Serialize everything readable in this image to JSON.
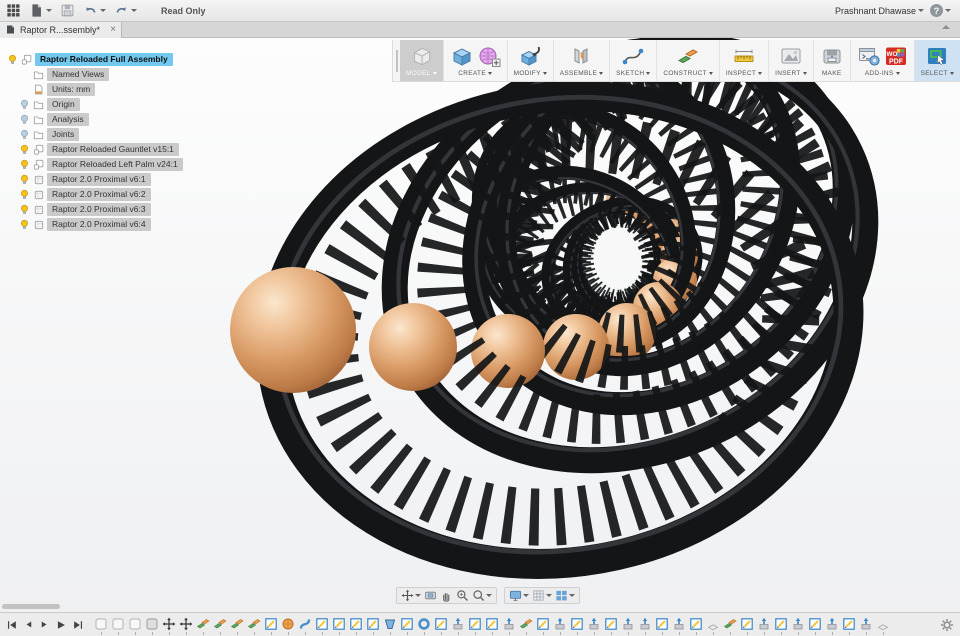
{
  "topbar": {
    "left_icons": [
      "app-grid",
      "file-menu",
      "save",
      "undo",
      "redo"
    ],
    "read_only_label": "Read Only",
    "user_name": "Prashnant Dhawase",
    "help_label": "?"
  },
  "tab_bar": {
    "active_tab": {
      "title": "Raptor R...ssembly*",
      "close_label": "×"
    }
  },
  "toolbar": {
    "groups": [
      {
        "label": "MODEL",
        "caret": true,
        "pressed": true,
        "selected": false,
        "icons": [
          "model-cube"
        ]
      },
      {
        "label": "CREATE",
        "caret": true,
        "pressed": false,
        "selected": false,
        "icons": [
          "create-box",
          "create-form"
        ]
      },
      {
        "label": "MODIFY",
        "caret": true,
        "pressed": false,
        "selected": false,
        "icons": [
          "modify-press"
        ]
      },
      {
        "label": "ASSEMBLE",
        "caret": true,
        "pressed": false,
        "selected": false,
        "icons": [
          "assemble-joint"
        ]
      },
      {
        "label": "SKETCH",
        "caret": true,
        "pressed": false,
        "selected": false,
        "icons": [
          "sketch-spline"
        ]
      },
      {
        "label": "CONSTRUCT",
        "caret": true,
        "pressed": false,
        "selected": false,
        "icons": [
          "construct-planes"
        ]
      },
      {
        "label": "INSPECT",
        "caret": true,
        "pressed": false,
        "selected": false,
        "icons": [
          "inspect-measure"
        ]
      },
      {
        "label": "INSERT",
        "caret": true,
        "pressed": false,
        "selected": false,
        "icons": [
          "insert-image"
        ]
      },
      {
        "label": "MAKE",
        "caret": false,
        "pressed": false,
        "selected": false,
        "icons": [
          "make-print"
        ]
      },
      {
        "label": "ADD-INS",
        "caret": true,
        "pressed": false,
        "selected": false,
        "icons": [
          "addins-scripts",
          "addins-pdf"
        ]
      },
      {
        "label": "SELECT",
        "caret": true,
        "pressed": false,
        "selected": true,
        "icons": [
          "select-tool"
        ]
      }
    ]
  },
  "browser": {
    "items": [
      {
        "label": "Raptor Reloaded Full Assembly",
        "icon": "component",
        "bulb": "on",
        "selected": true,
        "level": 0
      },
      {
        "label": "Named Views",
        "icon": "folder",
        "bulb": null,
        "selected": false,
        "level": 1
      },
      {
        "label": "Units: mm",
        "icon": "units-doc",
        "bulb": null,
        "selected": false,
        "level": 1
      },
      {
        "label": "Origin",
        "icon": "folder",
        "bulb": "off",
        "selected": false,
        "level": 1
      },
      {
        "label": "Analysis",
        "icon": "folder",
        "bulb": "off",
        "selected": false,
        "level": 1
      },
      {
        "label": "Joints",
        "icon": "folder",
        "bulb": "off",
        "selected": false,
        "level": 1
      },
      {
        "label": "Raptor Reloaded Gauntlet v15:1",
        "icon": "component",
        "bulb": "on",
        "selected": false,
        "level": 1
      },
      {
        "label": "Raptor Reloaded Left Palm v24:1",
        "icon": "component",
        "bulb": "on",
        "selected": false,
        "level": 1
      },
      {
        "label": "Raptor 2.0 Proximal v6:1",
        "icon": "body",
        "bulb": "on",
        "selected": false,
        "level": 1
      },
      {
        "label": "Raptor 2.0 Proximal v6:2",
        "icon": "body",
        "bulb": "on",
        "selected": false,
        "level": 1
      },
      {
        "label": "Raptor 2.0 Proximal v6:3",
        "icon": "body",
        "bulb": "on",
        "selected": false,
        "level": 1
      },
      {
        "label": "Raptor 2.0 Proximal v6:4",
        "icon": "body",
        "bulb": "on",
        "selected": false,
        "level": 1
      }
    ]
  },
  "navbar": {
    "groups": [
      {
        "items": [
          {
            "name": "orbit",
            "caret": true
          },
          {
            "name": "look-at",
            "caret": false
          },
          {
            "name": "pan",
            "caret": false
          },
          {
            "name": "zoom",
            "caret": false
          },
          {
            "name": "fit",
            "caret": true
          }
        ]
      },
      {
        "items": [
          {
            "name": "display-settings",
            "caret": true
          },
          {
            "name": "grid-settings",
            "caret": true
          },
          {
            "name": "viewports",
            "caret": true
          }
        ]
      }
    ]
  },
  "timeline": {
    "playback": [
      "go-to-start",
      "step-back",
      "step-forward",
      "play",
      "go-to-end"
    ],
    "items": [
      "component",
      "component",
      "component",
      "body",
      "move",
      "move",
      "plane",
      "plane",
      "plane",
      "plane",
      "sketch",
      "form",
      "sweep",
      "sketch",
      "sketch",
      "sketch",
      "sketch",
      "loft",
      "sketch",
      "torus",
      "sketch",
      "extrude",
      "sketch",
      "sketch",
      "extrude",
      "plane",
      "sketch",
      "extrude",
      "sketch",
      "extrude",
      "sketch",
      "extrude",
      "extrude",
      "sketch",
      "extrude",
      "sketch",
      "fillet",
      "plane",
      "sketch",
      "extrude",
      "sketch",
      "extrude",
      "sketch",
      "extrude",
      "sketch",
      "extrude",
      "fillet"
    ],
    "settings_icon": "gear"
  },
  "viewport": {
    "description": "spiral assembly of black carbon-fiber gauntlet rings with copper spheres",
    "ring_color": "#141517",
    "ring_highlight": "#4d5158",
    "copper_stops": [
      "#fbe7cd",
      "#f0c49a",
      "#d99b66",
      "#bc7a46",
      "#8e5630"
    ],
    "rings": [
      [
        560,
        330,
        290,
        232,
        -10,
        30
      ],
      [
        630,
        255,
        243,
        196,
        -25,
        26
      ],
      [
        659,
        225,
        200,
        162,
        -40,
        23
      ],
      [
        648,
        205,
        168,
        134,
        -62,
        20
      ],
      [
        612,
        205,
        140,
        114,
        -95,
        18
      ],
      [
        584,
        222,
        118,
        96,
        -126,
        16
      ],
      [
        578,
        258,
        100,
        82,
        -156,
        14
      ],
      [
        590,
        260,
        88,
        72,
        178,
        12
      ],
      [
        622,
        266,
        77,
        62,
        158,
        11
      ],
      [
        610,
        266,
        67,
        54,
        139,
        10
      ],
      [
        618,
        260,
        59,
        48,
        119,
        9
      ],
      [
        618,
        258,
        53,
        43,
        102,
        8
      ],
      [
        618,
        258,
        48,
        39,
        88,
        7
      ]
    ],
    "spheres": [
      [
        293,
        330,
        63
      ],
      [
        413,
        347,
        44
      ],
      [
        508,
        351,
        37
      ],
      [
        576,
        347,
        33
      ],
      [
        627,
        332,
        29
      ],
      [
        658,
        307,
        25
      ],
      [
        675,
        280,
        22
      ],
      [
        679,
        256,
        19
      ],
      [
        672,
        236,
        17
      ],
      [
        660,
        221,
        15
      ],
      [
        645,
        210,
        13
      ],
      [
        630,
        203,
        11
      ],
      [
        616,
        200,
        10
      ]
    ]
  }
}
